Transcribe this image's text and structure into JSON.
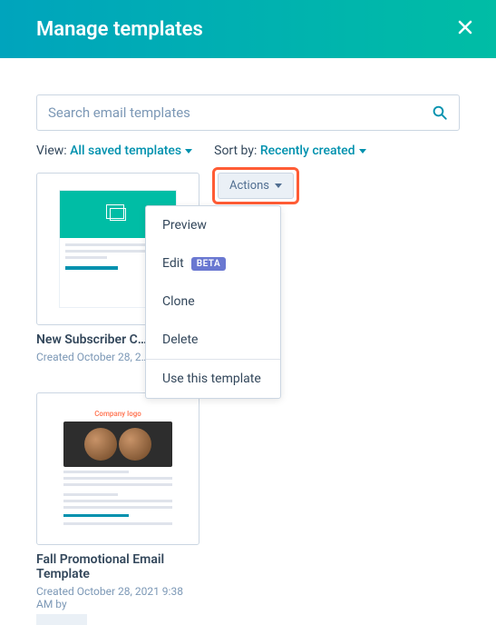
{
  "header": {
    "title": "Manage templates"
  },
  "search": {
    "placeholder": "Search email templates"
  },
  "view": {
    "label": "View:",
    "value": "All saved templates"
  },
  "sort": {
    "label": "Sort by:",
    "value": "Recently created"
  },
  "actions": {
    "button": "Actions",
    "menu": {
      "preview": "Preview",
      "edit": "Edit",
      "edit_badge": "BETA",
      "clone": "Clone",
      "delete": "Delete",
      "use": "Use this template"
    }
  },
  "card1": {
    "title": "New Subscriber C…",
    "meta": "Created October 28, 2…"
  },
  "card2": {
    "thumb_logo": "Company logo",
    "title": "Fall Promotional Email Template",
    "meta": "Created October 28, 2021 9:38 AM by"
  }
}
